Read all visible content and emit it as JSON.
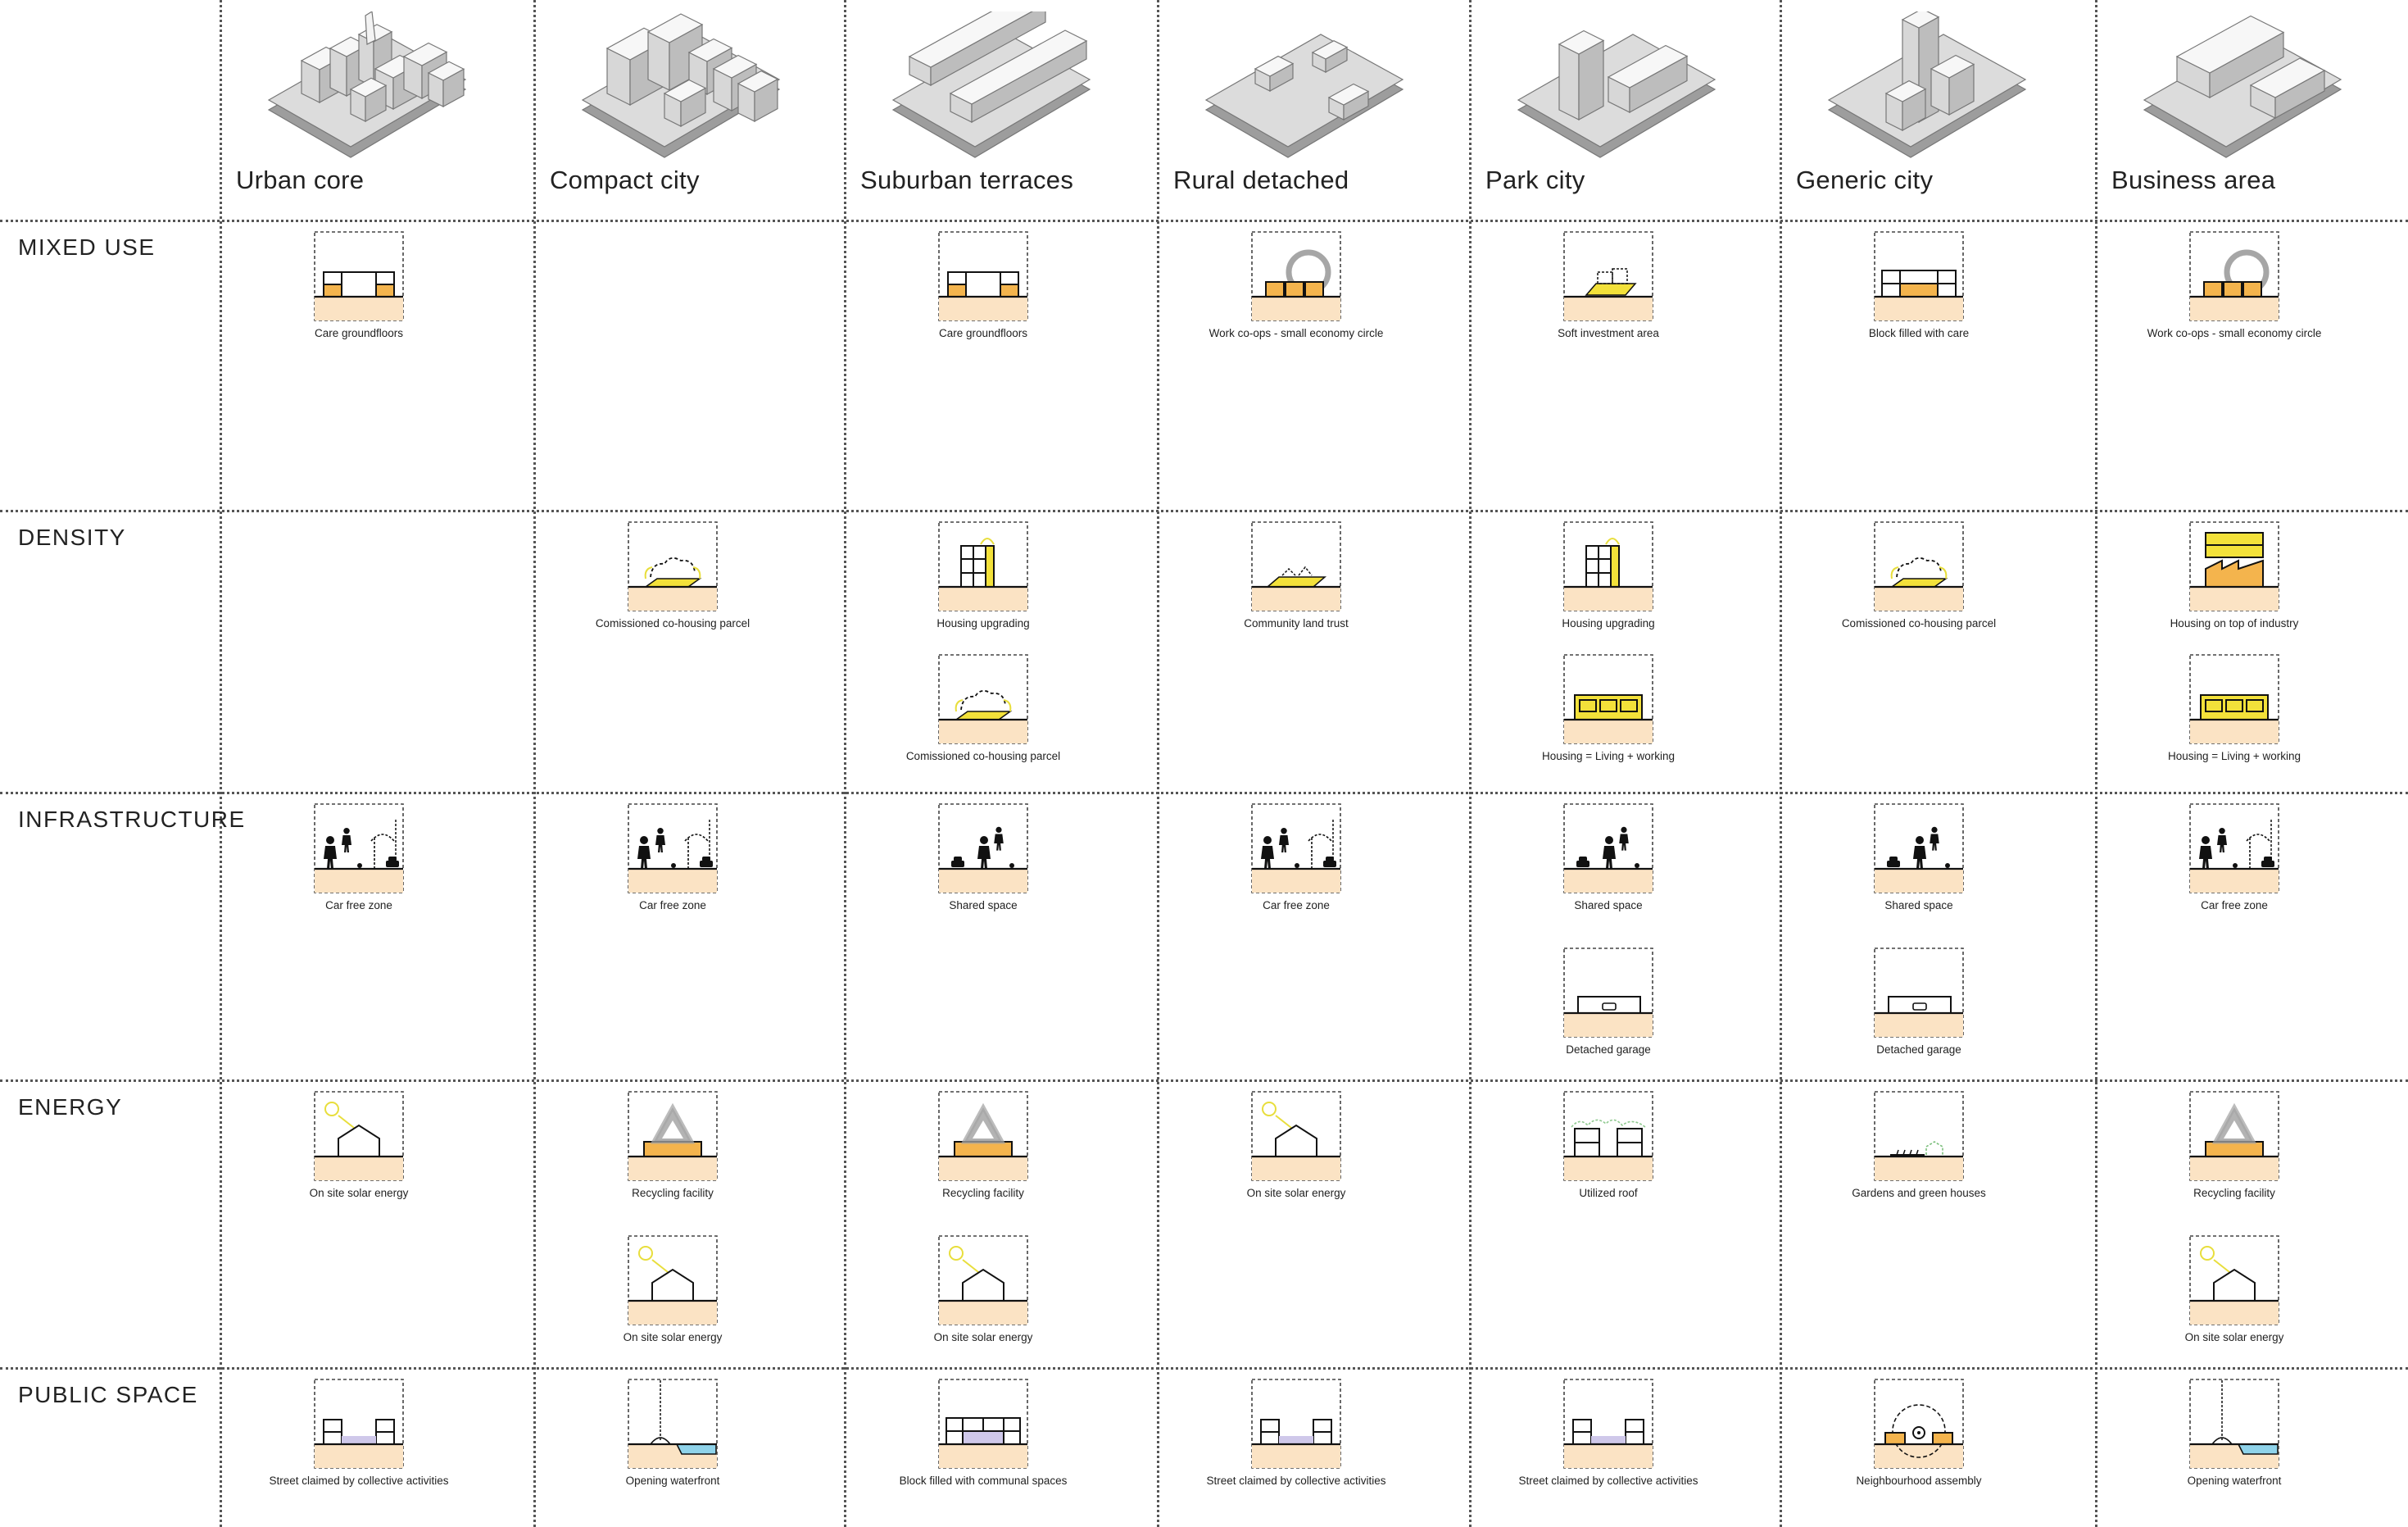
{
  "columns": [
    {
      "name": "Urban core",
      "icon": "urban-core-model-icon"
    },
    {
      "name": "Compact city",
      "icon": "compact-city-model-icon"
    },
    {
      "name": "Suburban terraces",
      "icon": "suburban-terraces-model-icon"
    },
    {
      "name": "Rural detached",
      "icon": "rural-detached-model-icon"
    },
    {
      "name": "Park city",
      "icon": "park-city-model-icon"
    },
    {
      "name": "Generic city",
      "icon": "generic-city-model-icon"
    },
    {
      "name": "Business area",
      "icon": "business-area-model-icon"
    }
  ],
  "rows": [
    "MIXED USE",
    "DENSITY",
    "INFRASTRUCTURE",
    "ENERGY",
    "PUBLIC SPACE"
  ],
  "colors": {
    "ground": "#fbe3c4",
    "yellow": "#f3e13a",
    "orange": "#f4b44d",
    "purple": "#cfc8ea",
    "water": "#8fd3ea",
    "sun": "#e8de3c",
    "grey": "#a6a6a6"
  },
  "cells": [
    {
      "row": 0,
      "col": 0,
      "icon": "care-groundfloors",
      "label": "Care groundfloors"
    },
    {
      "row": 0,
      "col": 2,
      "icon": "care-groundfloors",
      "label": "Care groundfloors"
    },
    {
      "row": 0,
      "col": 3,
      "icon": "work-coops",
      "label": "Work co-ops - small economy circle"
    },
    {
      "row": 0,
      "col": 4,
      "icon": "soft-investment",
      "label": "Soft investment area"
    },
    {
      "row": 0,
      "col": 5,
      "icon": "block-filled-care",
      "label": "Block filled with care"
    },
    {
      "row": 0,
      "col": 6,
      "icon": "work-coops",
      "label": "Work co-ops - small economy circle"
    },
    {
      "row": 1,
      "col": 1,
      "slot": 0,
      "icon": "cohousing-parcel",
      "label": "Comissioned co-housing parcel"
    },
    {
      "row": 1,
      "col": 2,
      "slot": 0,
      "icon": "housing-upgrading",
      "label": "Housing upgrading"
    },
    {
      "row": 1,
      "col": 2,
      "slot": 1,
      "icon": "cohousing-parcel",
      "label": "Comissioned co-housing parcel"
    },
    {
      "row": 1,
      "col": 3,
      "slot": 0,
      "icon": "community-land-trust",
      "label": "Community land trust"
    },
    {
      "row": 1,
      "col": 4,
      "slot": 0,
      "icon": "housing-upgrading",
      "label": "Housing upgrading"
    },
    {
      "row": 1,
      "col": 4,
      "slot": 1,
      "icon": "living-working",
      "label": "Housing = Living + working"
    },
    {
      "row": 1,
      "col": 5,
      "slot": 0,
      "icon": "cohousing-parcel",
      "label": "Comissioned co-housing parcel"
    },
    {
      "row": 1,
      "col": 6,
      "slot": 0,
      "icon": "housing-industry",
      "label": "Housing on top of industry"
    },
    {
      "row": 1,
      "col": 6,
      "slot": 1,
      "icon": "living-working",
      "label": "Housing = Living + working"
    },
    {
      "row": 2,
      "col": 0,
      "slot": 0,
      "icon": "car-free-zone",
      "label": "Car free zone"
    },
    {
      "row": 2,
      "col": 1,
      "slot": 0,
      "icon": "car-free-zone",
      "label": "Car free zone"
    },
    {
      "row": 2,
      "col": 2,
      "slot": 0,
      "icon": "shared-space",
      "label": "Shared space"
    },
    {
      "row": 2,
      "col": 3,
      "slot": 0,
      "icon": "car-free-zone",
      "label": "Car free zone"
    },
    {
      "row": 2,
      "col": 4,
      "slot": 0,
      "icon": "shared-space",
      "label": "Shared space"
    },
    {
      "row": 2,
      "col": 4,
      "slot": 1,
      "icon": "detached-garage",
      "label": "Detached garage"
    },
    {
      "row": 2,
      "col": 5,
      "slot": 0,
      "icon": "shared-space",
      "label": "Shared space"
    },
    {
      "row": 2,
      "col": 5,
      "slot": 1,
      "icon": "detached-garage",
      "label": "Detached garage"
    },
    {
      "row": 2,
      "col": 6,
      "slot": 0,
      "icon": "car-free-zone",
      "label": "Car free zone"
    },
    {
      "row": 3,
      "col": 0,
      "slot": 0,
      "icon": "solar-energy",
      "label": "On site solar energy"
    },
    {
      "row": 3,
      "col": 1,
      "slot": 0,
      "icon": "recycling",
      "label": "Recycling facility"
    },
    {
      "row": 3,
      "col": 1,
      "slot": 1,
      "icon": "solar-energy",
      "label": "On site solar energy"
    },
    {
      "row": 3,
      "col": 2,
      "slot": 0,
      "icon": "recycling",
      "label": "Recycling facility"
    },
    {
      "row": 3,
      "col": 2,
      "slot": 1,
      "icon": "solar-energy",
      "label": "On site solar energy"
    },
    {
      "row": 3,
      "col": 3,
      "slot": 0,
      "icon": "solar-energy",
      "label": "On site solar energy"
    },
    {
      "row": 3,
      "col": 4,
      "slot": 0,
      "icon": "utilized-roof",
      "label": "Utilized roof"
    },
    {
      "row": 3,
      "col": 5,
      "slot": 0,
      "icon": "gardens",
      "label": "Gardens and green houses"
    },
    {
      "row": 3,
      "col": 6,
      "slot": 0,
      "icon": "recycling",
      "label": "Recycling facility"
    },
    {
      "row": 3,
      "col": 6,
      "slot": 1,
      "icon": "solar-energy",
      "label": "On site solar energy"
    },
    {
      "row": 4,
      "col": 0,
      "icon": "street-claimed",
      "label": "Street claimed by collective activities"
    },
    {
      "row": 4,
      "col": 1,
      "icon": "waterfront",
      "label": "Opening waterfront"
    },
    {
      "row": 4,
      "col": 2,
      "icon": "block-communal",
      "label": "Block filled with communal spaces"
    },
    {
      "row": 4,
      "col": 3,
      "icon": "street-claimed",
      "label": "Street claimed by collective activities"
    },
    {
      "row": 4,
      "col": 4,
      "icon": "street-claimed",
      "label": "Street claimed by collective activities"
    },
    {
      "row": 4,
      "col": 5,
      "icon": "neighbourhood-assembly",
      "label": "Neighbourhood assembly"
    },
    {
      "row": 4,
      "col": 6,
      "icon": "waterfront",
      "label": "Opening waterfront"
    }
  ]
}
